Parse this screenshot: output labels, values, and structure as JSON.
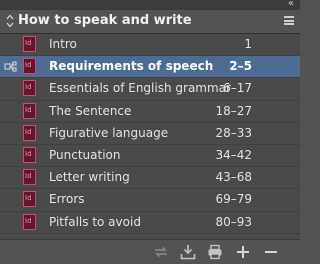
{
  "panel": {
    "title": "How to speak and write"
  },
  "chapters": [
    {
      "label": "Intro",
      "range": "1",
      "selected": false
    },
    {
      "label": "Requirements of speech",
      "range": "2–5",
      "selected": true
    },
    {
      "label": "Essentials of English grammar",
      "range": "6–17",
      "selected": false
    },
    {
      "label": "The Sentence",
      "range": "18–27",
      "selected": false
    },
    {
      "label": "Figurative language",
      "range": "28–33",
      "selected": false
    },
    {
      "label": "Punctuation",
      "range": "34–42",
      "selected": false
    },
    {
      "label": "Letter writing",
      "range": "43–68",
      "selected": false
    },
    {
      "label": "Errors",
      "range": "69–79",
      "selected": false
    },
    {
      "label": "Pitfalls to avoid",
      "range": "80–93",
      "selected": false
    }
  ],
  "icons": {
    "collapse": "double-chevron-collapse-icon",
    "sort": "sort-updown-icon",
    "menu": "panel-menu-icon",
    "document": "indesign-document-icon",
    "sync_source": "style-source-sync-icon",
    "footer": [
      "synchronize-icon",
      "save-book-icon",
      "print-book-icon",
      "add-document-icon",
      "remove-document-icon"
    ]
  },
  "colors": {
    "panel_bg": "#4a4a4a",
    "header_bg": "#535353",
    "selected_row": "#4e6c92",
    "doc_icon_border": "#d24a6e"
  }
}
